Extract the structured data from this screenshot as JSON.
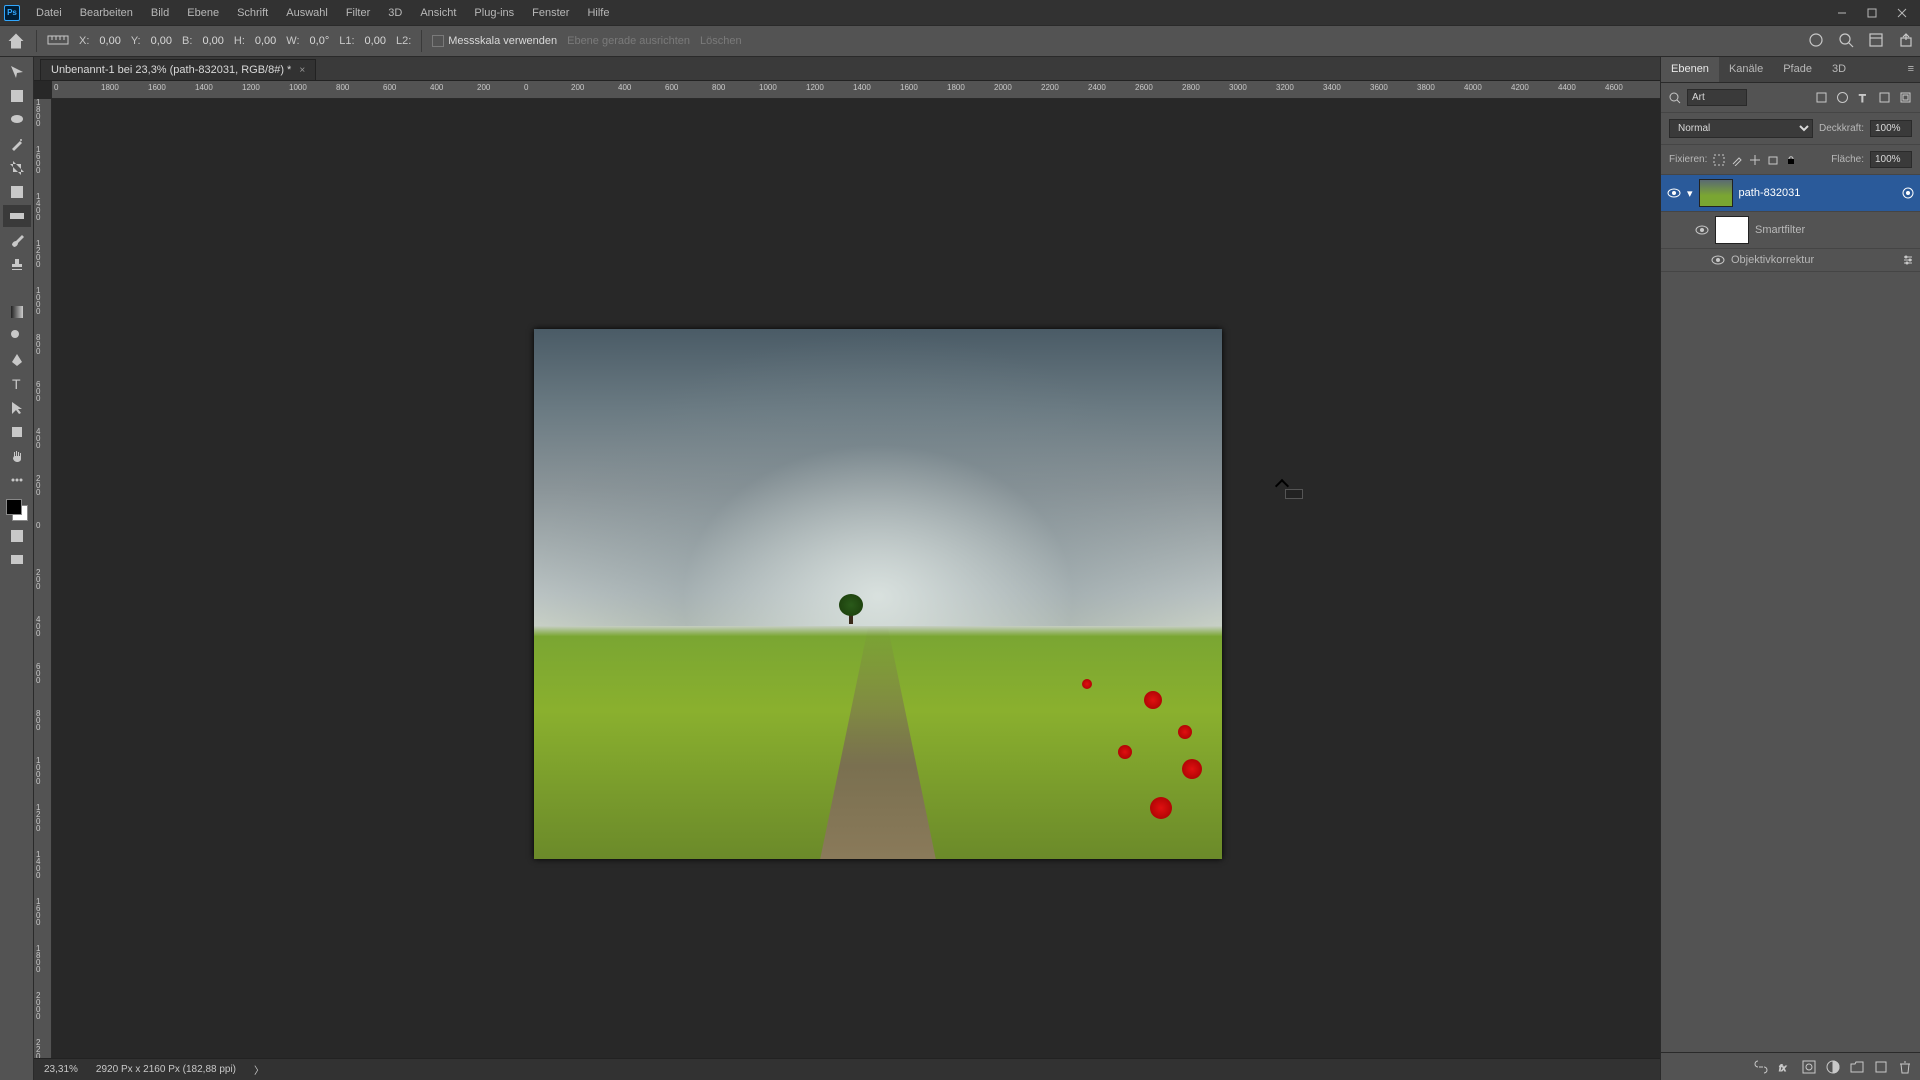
{
  "menu": [
    "Datei",
    "Bearbeiten",
    "Bild",
    "Ebene",
    "Schrift",
    "Auswahl",
    "Filter",
    "3D",
    "Ansicht",
    "Plug-ins",
    "Fenster",
    "Hilfe"
  ],
  "options": {
    "x_label": "X:",
    "x_val": "0,00",
    "y_label": "Y:",
    "y_val": "0,00",
    "b_label": "B:",
    "b_val": "0,00",
    "h_label": "H:",
    "h_val": "0,00",
    "w_label": "W:",
    "w_val": "0,0°",
    "l1_label": "L1:",
    "l1_val": "0,00",
    "l2_label": "L2:",
    "use_scale": "Messskala verwenden",
    "straighten": "Ebene gerade ausrichten",
    "clear": "Löschen"
  },
  "doc_tab": "Unbenannt-1 bei 23,3% (path-832031, RGB/8#) *",
  "ruler_h": [
    "0",
    "1800",
    "1600",
    "1400",
    "1200",
    "1000",
    "800",
    "600",
    "400",
    "200",
    "0",
    "200",
    "400",
    "600",
    "800",
    "1000",
    "1200",
    "1400",
    "1600",
    "1800",
    "2000",
    "2200",
    "2400",
    "2600",
    "2800",
    "3000",
    "3200",
    "3400",
    "3600",
    "3800",
    "4000",
    "4200",
    "4400",
    "4600"
  ],
  "ruler_v": [
    "1800",
    "1600",
    "1400",
    "1200",
    "1000",
    "800",
    "600",
    "400",
    "200",
    "0",
    "200",
    "400",
    "600",
    "800",
    "1000",
    "1200",
    "1400",
    "1600",
    "1800",
    "2000",
    "2200"
  ],
  "status": {
    "zoom": "23,31%",
    "dims": "2920 Px x 2160 Px (182,88 ppi)",
    "arrow": "〉"
  },
  "panels": {
    "tabs": [
      "Ebenen",
      "Kanäle",
      "Pfade",
      "3D"
    ],
    "search_placeholder": "Art",
    "blend": "Normal",
    "opacity_label": "Deckkraft:",
    "opacity": "100%",
    "lock_label": "Fixieren:",
    "fill_label": "Fläche:",
    "fill": "100%",
    "layer1": "path-832031",
    "layer2": "Smartfilter",
    "layer3": "Objektivkorrektur"
  }
}
